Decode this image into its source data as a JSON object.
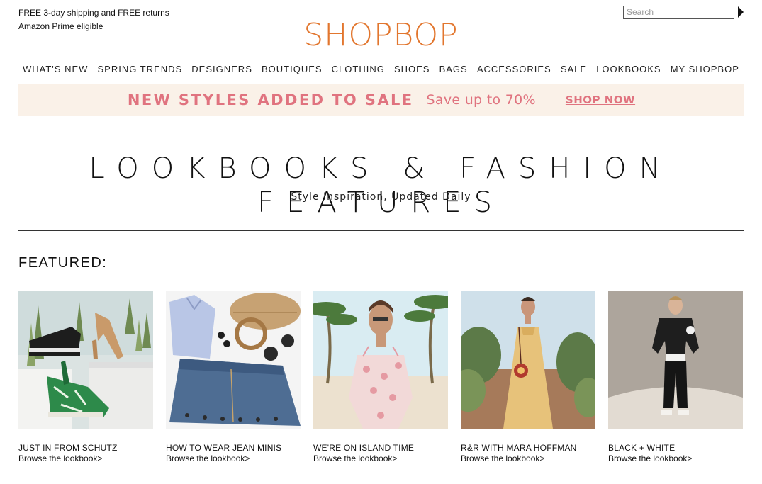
{
  "header": {
    "shipping_line1": "FREE 3-day shipping and FREE returns",
    "shipping_line2": "Amazon Prime eligible",
    "logo": "SHOPBOP",
    "search": {
      "placeholder": "Search"
    }
  },
  "nav": {
    "items": [
      "WHAT'S NEW",
      "SPRING TRENDS",
      "DESIGNERS",
      "BOUTIQUES",
      "CLOTHING",
      "SHOES",
      "BAGS",
      "ACCESSORIES",
      "SALE",
      "LOOKBOOKS",
      "MY SHOPBOP"
    ]
  },
  "banner": {
    "headline": "NEW STYLES ADDED TO SALE",
    "subtext": "Save up to 70%",
    "cta": "SHOP NOW",
    "background_color": "#faf1e8",
    "text_color": "#e0737f"
  },
  "hero": {
    "title": "LOOKBOOKS & FASHION FEATURES",
    "subtitle": "Style Inspiration, Updated Daily"
  },
  "featured": {
    "heading": "FEATURED:",
    "cards": [
      {
        "title": "JUST IN FROM SCHUTZ",
        "link": "Browse the lookbook>"
      },
      {
        "title": "HOW TO WEAR JEAN MINIS",
        "link": "Browse the lookbook>"
      },
      {
        "title": "WE'RE ON ISLAND TIME",
        "link": "Browse the lookbook>"
      },
      {
        "title": "R&R WITH MARA HOFFMAN",
        "link": "Browse the lookbook>"
      },
      {
        "title": "BLACK + WHITE",
        "link": "Browse the lookbook>"
      }
    ]
  },
  "colors": {
    "brand": "#e2762e"
  }
}
